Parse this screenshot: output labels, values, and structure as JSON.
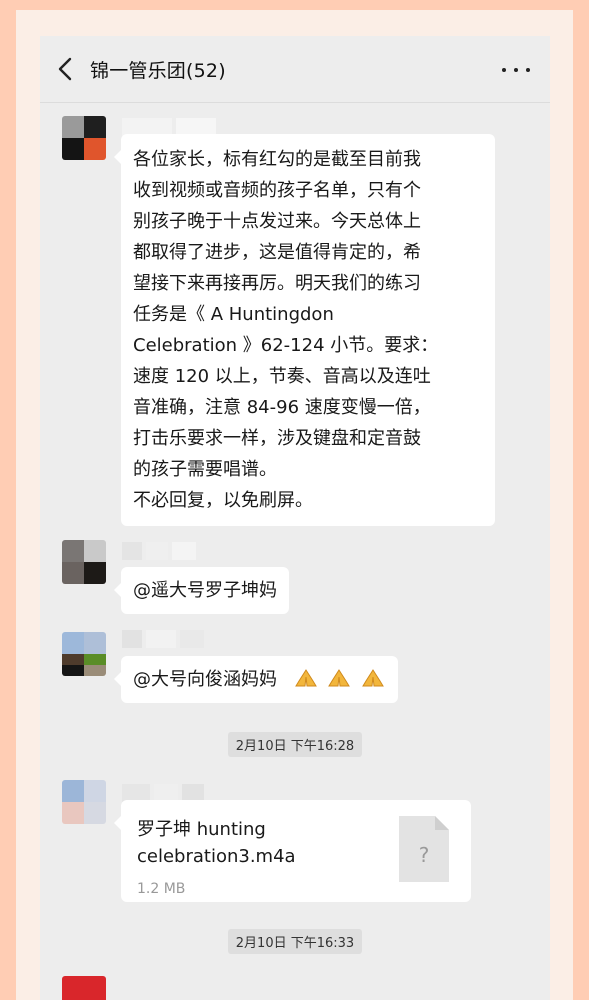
{
  "header": {
    "title": "锦一管乐团(52)"
  },
  "messages": [
    {
      "text": "各位家长，标有红勾的是截至目前我\n收到视频或音频的孩子名单，只有个\n别孩子晚于十点发过来。今天总体上\n都取得了进步，这是值得肯定的，希\n望接下来再接再厉。明天我们的练习\n任务是《 A Huntingdon\nCelebration 》62-124 小节。要求：\n速度 120 以上，节奏、音高以及连吐\n音准确，注意 84-96 速度变慢一倍，\n打击乐要求一样，涉及键盘和定音鼓\n的孩子需要唱谱。\n不必回复，以免刷屏。"
    },
    {
      "text": "@遥大号罗子坤妈"
    },
    {
      "text": "@大号向俊涵妈妈",
      "emoji_icon": "praying-hands-icon"
    }
  ],
  "timestamps": [
    "2月10日 下午16:28",
    "2月10日 下午16:33"
  ],
  "file_message": {
    "file_name_line1": "罗子坤 hunting",
    "file_name_line2": "celebration3.m4a",
    "file_size": "1.2 MB",
    "file_icon": "unknown-file-icon",
    "file_icon_glyph": "?"
  },
  "colors": {
    "page_bg": "#ffcdb4",
    "chat_bg": "#ededed",
    "bubble": "#ffffff",
    "accent_red": "#e54a2e"
  }
}
